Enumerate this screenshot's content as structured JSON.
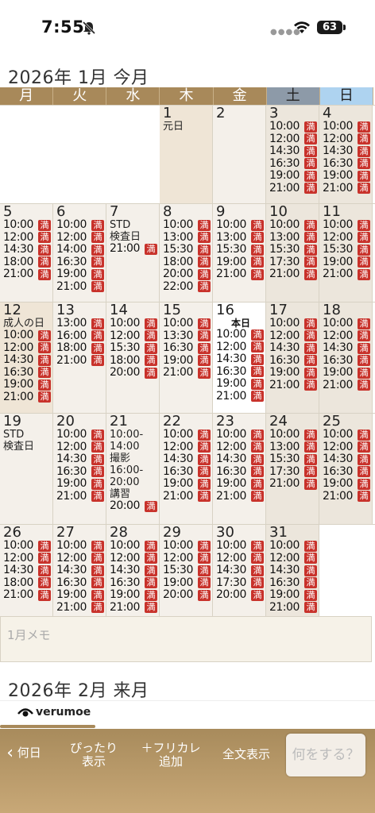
{
  "status": {
    "time": "7:55",
    "battery": "63"
  },
  "jan_title": "2026年 1月 今月",
  "feb_title": "2026年 2月 来月",
  "weekdays": [
    "月",
    "火",
    "水",
    "木",
    "金",
    "土",
    "日"
  ],
  "full_mark": "満",
  "weeks": [
    [
      null,
      null,
      null,
      {
        "d": "1",
        "note": "元日",
        "type": "hol",
        "slots": []
      },
      {
        "d": "2",
        "type": "",
        "slots": []
      },
      {
        "d": "3",
        "type": "wkend",
        "slots": [
          "10:00",
          "12:00",
          "14:30",
          "16:30",
          "19:00",
          "21:00"
        ]
      },
      {
        "d": "4",
        "type": "wkend",
        "slots": [
          "10:00",
          "12:00",
          "14:30",
          "16:30",
          "19:00",
          "21:00"
        ]
      }
    ],
    [
      {
        "d": "5",
        "type": "",
        "slots": [
          "10:00",
          "12:00",
          "14:30",
          "18:00",
          "21:00"
        ]
      },
      {
        "d": "6",
        "type": "",
        "slots": [
          "10:00",
          "12:00",
          "14:00",
          "16:30",
          "19:00",
          "21:00"
        ]
      },
      {
        "d": "7",
        "note": "STD\n検査日",
        "type": "",
        "slots": [
          "21:00"
        ]
      },
      {
        "d": "8",
        "type": "",
        "slots": [
          "10:00",
          "13:00",
          "15:30",
          "18:00",
          "20:00",
          "22:00"
        ]
      },
      {
        "d": "9",
        "type": "",
        "slots": [
          "10:00",
          "13:00",
          "15:30",
          "19:00",
          "21:00"
        ]
      },
      {
        "d": "10",
        "type": "wkend",
        "slots": [
          "10:00",
          "13:00",
          "15:30",
          "17:30",
          "21:00"
        ]
      },
      {
        "d": "11",
        "type": "wkend",
        "slots": [
          "10:00",
          "12:00",
          "15:30",
          "19:00",
          "21:00"
        ]
      }
    ],
    [
      {
        "d": "12",
        "note": "成人の日",
        "type": "hol",
        "slots": [
          "10:00",
          "12:00",
          "14:30",
          "16:30",
          "19:00",
          "21:00"
        ]
      },
      {
        "d": "13",
        "type": "",
        "slots": [
          "13:00",
          "16:00",
          "18:00",
          "21:00"
        ]
      },
      {
        "d": "14",
        "type": "",
        "slots": [
          "10:00",
          "12:00",
          "15:30",
          "18:00",
          "20:00"
        ]
      },
      {
        "d": "15",
        "type": "",
        "slots": [
          "10:00",
          "13:30",
          "16:30",
          "19:00",
          "21:00"
        ]
      },
      {
        "d": "16",
        "today": "本日",
        "type": "today",
        "slots": [
          "10:00",
          "12:00",
          "14:30",
          "16:30",
          "19:00",
          "21:00"
        ]
      },
      {
        "d": "17",
        "type": "wkend",
        "slots": [
          "10:00",
          "12:00",
          "14:30",
          "16:30",
          "19:00",
          "21:00"
        ]
      },
      {
        "d": "18",
        "type": "wkend",
        "slots": [
          "10:00",
          "12:00",
          "14:30",
          "16:30",
          "19:00",
          "21:00"
        ]
      }
    ],
    [
      {
        "d": "19",
        "note": "STD\n検査日",
        "type": "",
        "slots": []
      },
      {
        "d": "20",
        "type": "",
        "slots": [
          "10:00",
          "12:00",
          "14:30",
          "16:30",
          "19:00",
          "21:00"
        ]
      },
      {
        "d": "21",
        "note": "10:00-\n14:00\n撮影\n16:00-\n20:00\n講習",
        "type": "",
        "slots": [
          "20:00"
        ]
      },
      {
        "d": "22",
        "type": "",
        "slots": [
          "10:00",
          "12:00",
          "14:30",
          "16:30",
          "19:00",
          "21:00"
        ]
      },
      {
        "d": "23",
        "type": "",
        "slots": [
          "10:00",
          "12:00",
          "14:30",
          "16:30",
          "19:00",
          "21:00"
        ]
      },
      {
        "d": "24",
        "type": "wkend",
        "slots": [
          "10:00",
          "13:00",
          "15:30",
          "17:30",
          "21:00"
        ]
      },
      {
        "d": "25",
        "type": "wkend",
        "slots": [
          "10:00",
          "12:00",
          "14:30",
          "16:30",
          "19:00",
          "21:00"
        ]
      }
    ],
    [
      {
        "d": "26",
        "type": "",
        "slots": [
          "10:00",
          "12:00",
          "14:30",
          "18:00",
          "21:00"
        ]
      },
      {
        "d": "27",
        "type": "",
        "slots": [
          "10:00",
          "12:00",
          "14:30",
          "16:30",
          "19:00",
          "21:00"
        ]
      },
      {
        "d": "28",
        "type": "",
        "slots": [
          "10:00",
          "12:00",
          "14:30",
          "16:30",
          "19:00",
          "21:00"
        ]
      },
      {
        "d": "29",
        "type": "",
        "slots": [
          "10:00",
          "12:00",
          "15:30",
          "19:00",
          "20:00"
        ]
      },
      {
        "d": "30",
        "type": "",
        "slots": [
          "10:00",
          "12:00",
          "14:30",
          "17:30",
          "20:00"
        ]
      },
      {
        "d": "31",
        "type": "wkend",
        "slots": [
          "10:00",
          "12:00",
          "14:30",
          "16:30",
          "19:00",
          "21:00"
        ]
      },
      null
    ]
  ],
  "memo_placeholder": "1月メモ",
  "brand": "verumoe",
  "toolbar": {
    "back": "何日",
    "fit": "ぴったり\n表示",
    "furikana": "＋フリカレ\n追加",
    "fulltext": "全文表示",
    "action": "何をする？"
  },
  "colors": {
    "gold": "#a8895a",
    "full": "#c8322b",
    "sat": "#8d9aa8",
    "sun": "#aed3f0"
  }
}
